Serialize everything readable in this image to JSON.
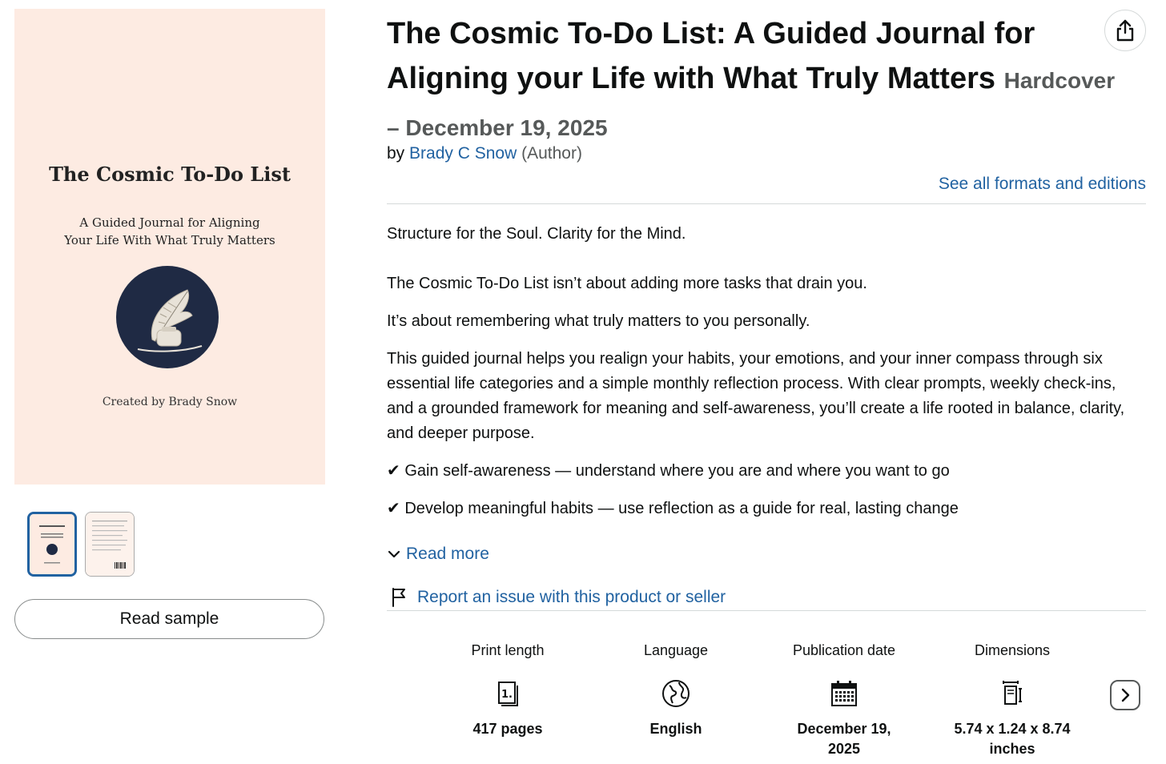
{
  "cover": {
    "title": "The Cosmic To-Do List",
    "subtitle_line1": "A Guided Journal for Aligning",
    "subtitle_line2": "Your Life With What Truly Matters",
    "credit": "Created by Brady Snow",
    "background": "#fdebe2",
    "emblem_color": "#1f2a44"
  },
  "thumbnails": [
    {
      "icon": "cover-thumbnail",
      "selected": true
    },
    {
      "icon": "back-cover-thumbnail",
      "selected": false
    }
  ],
  "read_sample_label": "Read sample",
  "product": {
    "title": "The Cosmic To-Do List: A Guided Journal for Aligning your Life with What Truly Matters",
    "binding": "Hardcover – December 19, 2025",
    "by_prefix": "by",
    "author": "Brady C Snow",
    "author_role": "(Author)",
    "see_all_formats": "See all formats and editions"
  },
  "description": {
    "p1": "Structure for the Soul. Clarity for the Mind.",
    "p2": "The Cosmic To-Do List isn’t about adding more tasks that drain you.",
    "p3": "It’s about remembering what truly matters to you personally.",
    "p4": "This guided journal helps you realign your habits, your emotions, and your inner compass through six essential life categories and a simple monthly reflection process. With clear prompts, weekly check-ins, and a grounded framework for meaning and self-awareness, you’ll create a life rooted in balance, clarity, and deeper purpose.",
    "b1": "✔ Gain self-awareness — understand where you are and where you want to go",
    "b2": "✔ Develop meaningful habits — use reflection as a guide for real, lasting change",
    "read_more": "Read more"
  },
  "report_link": "Report an issue with this product or seller",
  "details": [
    {
      "label": "Print length",
      "value_line1": "417 pages",
      "value_line2": "",
      "icon": "book-pages-icon"
    },
    {
      "label": "Language",
      "value_line1": "English",
      "value_line2": "",
      "icon": "globe-icon"
    },
    {
      "label": "Publication date",
      "value_line1": "December 19,",
      "value_line2": "2025",
      "icon": "calendar-icon"
    },
    {
      "label": "Dimensions",
      "value_line1": "5.74 x 1.24 x 8.74",
      "value_line2": "inches",
      "icon": "dimensions-icon"
    }
  ],
  "colors": {
    "link": "#2162a1",
    "text": "#0f1111",
    "secondary_text": "#565959",
    "divider": "#d5d9d9"
  }
}
